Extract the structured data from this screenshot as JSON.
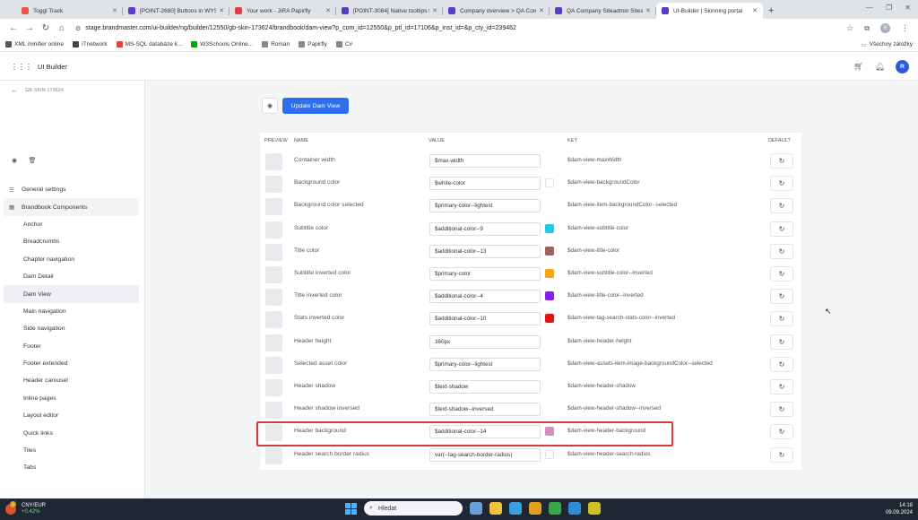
{
  "browser": {
    "tabs": [
      {
        "title": "Toggl Track",
        "color": "#e4564a",
        "active": false
      },
      {
        "title": "[POINT-2680] Buttons in WYSI...",
        "color": "#5b3cc4",
        "active": false
      },
      {
        "title": "Your work - JIRA Papirfly",
        "color": "#e04040",
        "active": false
      },
      {
        "title": "[POINT-3084] Native tooltips fo...",
        "color": "#5b3cc4",
        "active": false
      },
      {
        "title": "Company overview > QA Comp...",
        "color": "#5b3cc4",
        "active": false
      },
      {
        "title": "QA Company Siteadmin Siteadm...",
        "color": "#5b3cc4",
        "active": false
      },
      {
        "title": "UI-Builder | Skinning portal",
        "color": "#5b3cc4",
        "active": true
      }
    ],
    "url": "stage.brandmaster.com/ui-builder/ng/builder/12550/gb-skin-173624/brandbook/dam-view?p_com_id=12550&p_ptl_id=17106&p_inst_id=&p_cty_id=239462",
    "profile_initial": "R",
    "bookmarks": [
      {
        "label": "XML minifier online",
        "color": "#555"
      },
      {
        "label": "ITnetwork",
        "color": "#444"
      },
      {
        "label": "MS-SQL databáze k...",
        "color": "#d44"
      },
      {
        "label": "W3Schools Online...",
        "color": "#0a0"
      },
      {
        "label": "Roman",
        "color": "#888"
      },
      {
        "label": "Papirfly",
        "color": "#888"
      },
      {
        "label": "C#",
        "color": "#888"
      }
    ],
    "other_bookmarks": "Všechny záložky"
  },
  "app": {
    "title": "UI Builder",
    "avatar_initial": "R"
  },
  "sidebar": {
    "skin_name": "GB-SKIN-173624",
    "menu": [
      {
        "label": "General settings",
        "type": "group",
        "icon": "list-icon"
      },
      {
        "label": "Brandbook Components",
        "type": "group-open",
        "icon": "grid-icon"
      },
      {
        "label": "Anchor",
        "type": "sub"
      },
      {
        "label": "Breadcrumbs",
        "type": "sub"
      },
      {
        "label": "Chapter navigation",
        "type": "sub"
      },
      {
        "label": "Dam Detail",
        "type": "sub"
      },
      {
        "label": "Dam View",
        "type": "sub-active"
      },
      {
        "label": "Main navigation",
        "type": "sub"
      },
      {
        "label": "Side navigation",
        "type": "sub"
      },
      {
        "label": "Footer",
        "type": "sub"
      },
      {
        "label": "Footer extended",
        "type": "sub"
      },
      {
        "label": "Header carousel",
        "type": "sub"
      },
      {
        "label": "Inline pages",
        "type": "sub"
      },
      {
        "label": "Layout editor",
        "type": "sub"
      },
      {
        "label": "Quick links",
        "type": "sub"
      },
      {
        "label": "Tiles",
        "type": "sub"
      },
      {
        "label": "Tabs",
        "type": "sub"
      }
    ]
  },
  "main": {
    "update_button": "Update Dam View",
    "table": {
      "headers": {
        "preview": "PREVIEW",
        "name": "NAME",
        "value": "VALUE",
        "key": "KEY",
        "default": "DEFAULT"
      },
      "rows": [
        {
          "name": "Container width",
          "value": "$max-width",
          "swatch": null,
          "key": "$dam-view-maxWidth"
        },
        {
          "name": "Background color",
          "value": "$white-color",
          "swatch": "#ffffff",
          "key": "$dam-view-backgroundColor"
        },
        {
          "name": "Background color selected",
          "value": "$primary-color--lightest",
          "swatch": null,
          "key": "$dam-view-item-backgroundColor--selected"
        },
        {
          "name": "Subtitle color",
          "value": "$additional-color--9",
          "swatch": "#1fc8e6",
          "key": "$dam-view-subtitle-color"
        },
        {
          "name": "Title color",
          "value": "$additional-color--13",
          "swatch": "#a0605e",
          "key": "$dam-view-title-color"
        },
        {
          "name": "Subtitle inverted color",
          "value": "$primary-color",
          "swatch": "#f5a70b",
          "key": "$dam-view-subtitle-color--inverted"
        },
        {
          "name": "Title inverted color",
          "value": "$additional-color--4",
          "swatch": "#8a1ef0",
          "key": "$dam-view-title-color--inverted"
        },
        {
          "name": "Stats inverted color",
          "value": "$additional-color--10",
          "swatch": "#e81212",
          "key": "$dam-view-tag-search-stats-color--inverted"
        },
        {
          "name": "Header height",
          "value": "360px",
          "swatch": null,
          "key": "$dam-view-header-height"
        },
        {
          "name": "Selected asset color",
          "value": "$primary-color--lightest",
          "swatch": null,
          "key": "$dam-view-assets-item-image-backgroundColor--selected"
        },
        {
          "name": "Header shadow",
          "value": "$text-shadow",
          "swatch": null,
          "key": "$dam-view-header-shadow"
        },
        {
          "name": "Header shadow inversed",
          "value": "$text-shadow--inversed",
          "swatch": null,
          "key": "$dam-view-header-shadow--inversed"
        },
        {
          "name": "Header background",
          "value": "$additional-color--14",
          "swatch": "#cf8fbf",
          "key": "$dam-view-header-background"
        },
        {
          "name": "Header search border radius",
          "value": "var(--tag-search-border-radius)",
          "swatch": "#ffffff",
          "key": "$dam-view-header-search-radius"
        }
      ]
    },
    "highlighted_row_index": 12
  },
  "taskbar": {
    "ticker_label": "CNY/EUR",
    "ticker_change": "+0,42%",
    "ticker_badge": "1",
    "search_placeholder": "Hledat",
    "time": "14:18",
    "date": "09.09.2024",
    "apps": [
      "#6aa0d8",
      "#f0c23a",
      "#3aa0e0",
      "#e0a020",
      "#3aa84a",
      "#2a8fd8",
      "#d0c020"
    ]
  }
}
